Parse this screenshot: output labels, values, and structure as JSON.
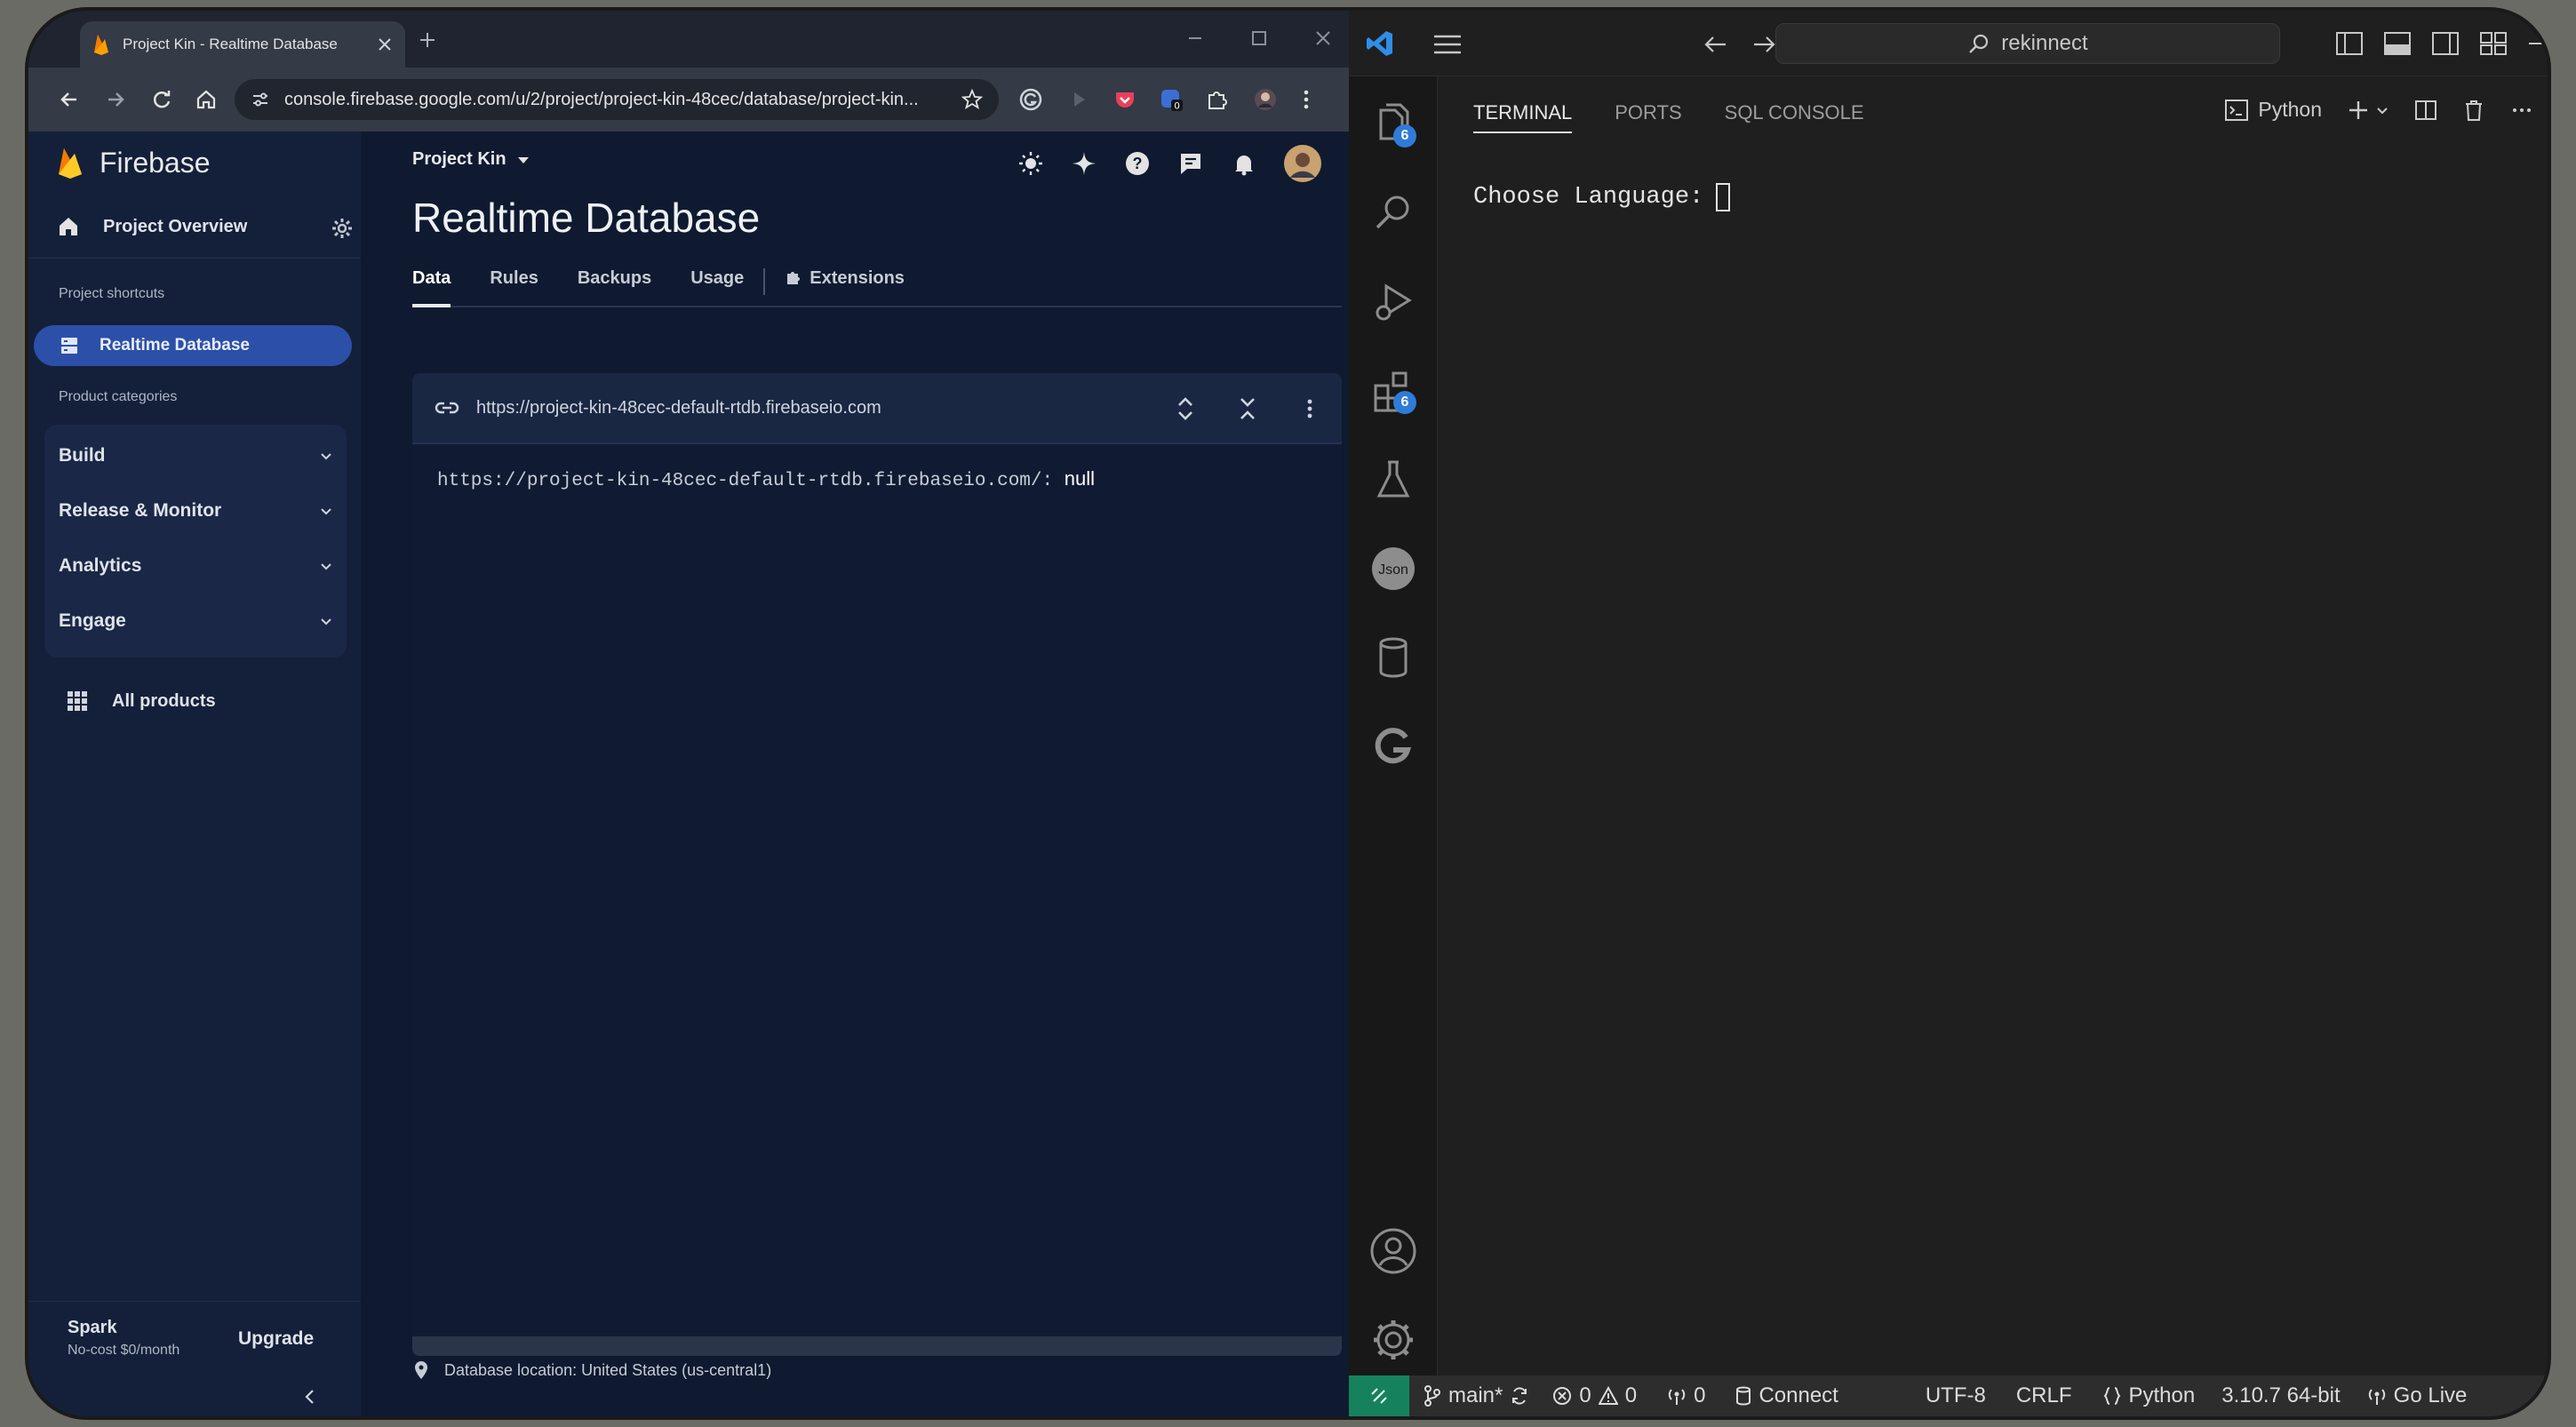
{
  "browser": {
    "tab_title": "Project Kin - Realtime Database",
    "url": "console.firebase.google.com/u/2/project/project-kin-48cec/database/project-kin..."
  },
  "firebase": {
    "brand": "Firebase",
    "project_overview": "Project Overview",
    "shortcuts_caption": "Project shortcuts",
    "active_item": "Realtime Database",
    "categories_caption": "Product categories",
    "categories": [
      {
        "label": "Build"
      },
      {
        "label": "Release & Monitor"
      },
      {
        "label": "Analytics"
      },
      {
        "label": "Engage"
      }
    ],
    "all_products": "All products",
    "plan_name": "Spark",
    "plan_detail": "No-cost $0/month",
    "upgrade": "Upgrade",
    "project_picker": "Project Kin",
    "page_title": "Realtime Database",
    "tabs": [
      "Data",
      "Rules",
      "Backups",
      "Usage",
      "Extensions"
    ],
    "db_url": "https://project-kin-48cec-default-rtdb.firebaseio.com",
    "db_node_path": "https://project-kin-48cec-default-rtdb.firebaseio.com/:",
    "db_node_value": "null",
    "db_location": "Database location: United States (us-central1)"
  },
  "vscode": {
    "search": "rekinnect",
    "badges": {
      "explorer": "6",
      "extensions": "6"
    },
    "panel_tabs": [
      "TERMINAL",
      "PORTS",
      "SQL CONSOLE"
    ],
    "terminal_profile": "Python",
    "terminal_prompt": "Choose Language:",
    "status": {
      "branch": "main*",
      "errors": "0",
      "warnings": "0",
      "ports": "0",
      "connect": "Connect",
      "encoding": "UTF-8",
      "eol": "CRLF",
      "language": "Python",
      "interpreter": "3.10.7 64-bit",
      "golive": "Go Live"
    }
  },
  "colors": {
    "firebase_active": "#2c4fa8",
    "vscode_accent": "#2f7bd8",
    "remote": "#16825d"
  }
}
